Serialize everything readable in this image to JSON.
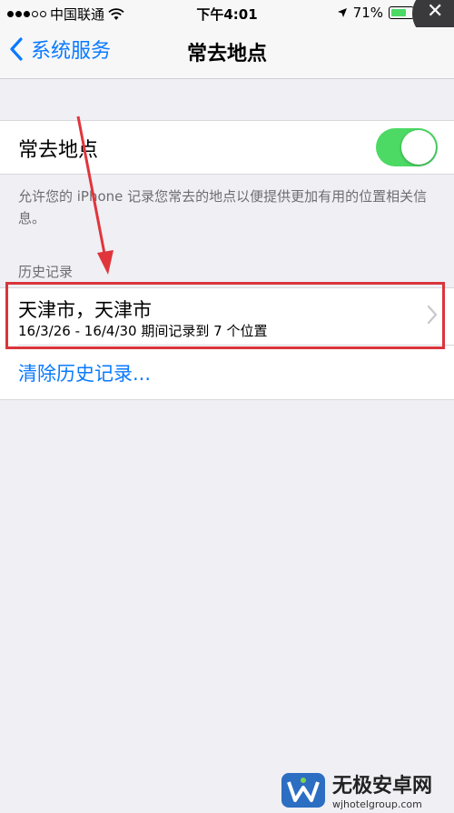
{
  "status_bar": {
    "carrier": "中国联通",
    "time": "下午4:01",
    "battery_percent": "71%",
    "battery_level": 0.71
  },
  "close_glyph": "✕",
  "nav": {
    "back_label": "系统服务",
    "title": "常去地点"
  },
  "toggle": {
    "label": "常去地点",
    "on": true
  },
  "footer_note": "允许您的 iPhone 记录您常去的地点以便提供更加有用的位置相关信息。",
  "history": {
    "section_header": "历史记录",
    "item_title": "天津市，天津市",
    "item_detail": "16/3/26 - 16/4/30 期间记录到 7 个位置",
    "clear_label": "清除历史记录..."
  },
  "watermark": {
    "title": "无极安卓网",
    "url": "wjhotelgroup.com"
  },
  "colors": {
    "accent": "#0a7aff",
    "switch_on": "#4cd964",
    "highlight": "#d9353b",
    "background": "#efeff4"
  }
}
